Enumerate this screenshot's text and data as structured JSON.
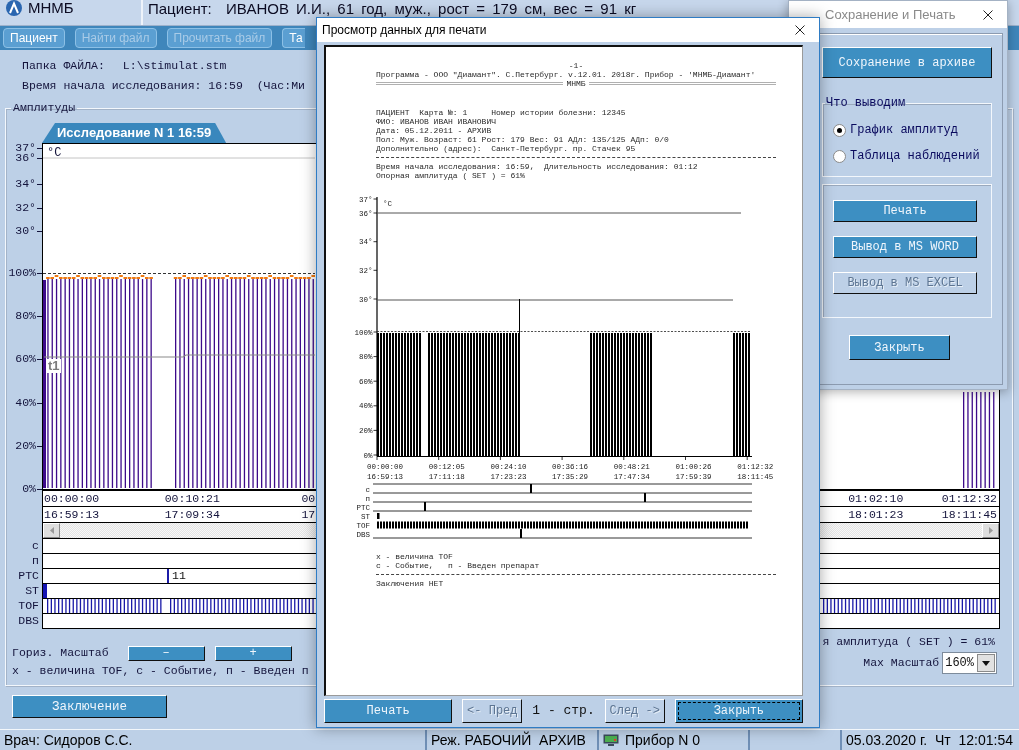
{
  "header": {
    "app_name": "МНМБ",
    "patient": "Пациент:  ИВАНОВ И.И., 61 год, муж., рост = 179 см, вес = 91 кг"
  },
  "toolbar": [
    {
      "label": "Пациент",
      "disabled": false
    },
    {
      "label": "Найти файл",
      "disabled": true
    },
    {
      "label": "Прочитать файл",
      "disabled": true
    },
    {
      "label": "Та",
      "disabled": false
    }
  ],
  "file_folder": {
    "label": "Папка ФАЙЛА:",
    "value": "L:\\stimulat.stm"
  },
  "start_time": "Время начала исследования: 16:59  (Час:Ми",
  "amplitudes": {
    "title": "Амплитуды",
    "tabs": [
      {
        "label": "Исследование N 1 16:59",
        "selected": true
      }
    ],
    "unit": "°C",
    "y_labels": [
      "37°",
      "36°",
      "34°",
      "32°",
      "30°",
      "100%",
      "80%",
      "60%",
      "40%",
      "20%",
      "0%"
    ],
    "trend_marker": "t1",
    "time_axis": {
      "left": [
        {
          "elapsed": "00:00:00",
          "clock": "16:59:13"
        },
        {
          "elapsed": "00:10:21",
          "clock": "17:09:34"
        },
        {
          "elapsed": "00",
          "clock": "17"
        }
      ],
      "right": [
        {
          "elapsed": "01:02:10",
          "clock": "18:01:23"
        },
        {
          "elapsed": "01:12:32",
          "clock": "18:11:45"
        }
      ]
    },
    "event_rows": [
      {
        "label": "с",
        "kind": "plain"
      },
      {
        "label": "п",
        "kind": "plain"
      },
      {
        "label": "PTC",
        "kind": "count",
        "value": "11"
      },
      {
        "label": "ST",
        "kind": "start"
      },
      {
        "label": "TOF",
        "kind": "train"
      },
      {
        "label": "DBS",
        "kind": "plain"
      }
    ],
    "scale": {
      "label": "Гориз. Масштаб",
      "buttons": [
        "–",
        "+"
      ]
    },
    "legend": "х - величина TOF, с - Событие, п - Введен п",
    "set_amplitude": "я амплитуда ( SET ) = 61%",
    "max_scale": {
      "label": "Max Масштаб",
      "value": "160%"
    }
  },
  "conclusion_button": "Заключение",
  "status_bar": {
    "doctor": "Врач: Сидоров С.С.",
    "mode": "Реж. РАБОЧИЙ  АРХИВ",
    "device": "Прибор N 0",
    "datetime": "05.03.2020 г.  Чт  12:01:54"
  },
  "print_preview": {
    "title": "Просмотр данных для печати",
    "active": true,
    "page": {
      "number": "-1-",
      "program": "Программа - ООО \"Диамант\". С.Петербург. v.12.01. 2018г. Прибор - 'МНМБ-Диамант'",
      "banner": "МНМБ",
      "patient_lines": [
        "ПАЦИЕНТ  Карта №: 1     Номер истории болезни: 12345",
        "ФИО: ИВАНОВ ИВАН ИВАНОВИЧ",
        "Дата: 05.12.2011 - АРХИВ",
        "Пол: Муж. Возраст: 61 Рост: 179 Вес: 91 АДл: 135/125 АДп: 0/0",
        "Дополнительно (адрес):  Санкт-Петербург. пр. Стачек 95"
      ],
      "study_lines": [
        "Время начала исследования: 16:59,  Длительность исследования: 01:12",
        "Опорная амплитуда ( SET ) = 61%"
      ],
      "chart": {
        "unit": "°C",
        "y_labels": [
          "37°",
          "36°",
          "34°",
          "32°",
          "30°",
          "100%",
          "80%",
          "60%",
          "40%",
          "20%",
          "0%"
        ],
        "time_labels": [
          {
            "elapsed": "00:00:00",
            "clock": "16:59:13"
          },
          {
            "elapsed": "00:12:05",
            "clock": "17:11:18"
          },
          {
            "elapsed": "00:24:10",
            "clock": "17:23:23"
          },
          {
            "elapsed": "00:36:16",
            "clock": "17:35:29"
          },
          {
            "elapsed": "00:48:21",
            "clock": "17:47:34"
          },
          {
            "elapsed": "01:00:26",
            "clock": "17:59:39"
          },
          {
            "elapsed": "01:12:32",
            "clock": "18:11:45"
          }
        ],
        "rows": [
          {
            "label": "с",
            "kind": "tick"
          },
          {
            "label": "п",
            "kind": "tick"
          },
          {
            "label": "PTC",
            "kind": "tick"
          },
          {
            "label": "ST",
            "kind": "start"
          },
          {
            "label": "TOF",
            "kind": "train"
          },
          {
            "label": "DBS",
            "kind": "tick"
          }
        ]
      },
      "legend_lines": [
        "х - величина TOF",
        "с - Событие,   п - Введен препарат"
      ],
      "conclusion": "Заключения НЕТ"
    },
    "footer": [
      {
        "kind": "button",
        "label": "Печать",
        "disabled": false,
        "focused": false
      },
      {
        "kind": "button",
        "label": "<- Пред",
        "disabled": true,
        "focused": false
      },
      {
        "kind": "counter",
        "label": "1 - стр."
      },
      {
        "kind": "button",
        "label": "След ->",
        "disabled": true,
        "focused": false
      },
      {
        "kind": "button",
        "label": "Закрыть",
        "disabled": false,
        "focused": true
      }
    ]
  },
  "save_dialog": {
    "title": "Сохранение и Печать",
    "active": false,
    "archive_button": "Сохранение в архиве",
    "output_group": {
      "title": "Что выводим",
      "options": [
        {
          "label": "График амплитуд",
          "selected": true
        },
        {
          "label": "Таблица наблюдений",
          "selected": false
        }
      ]
    },
    "actions": [
      {
        "label": "Печать",
        "disabled": false
      },
      {
        "label": "Вывод в MS WORD",
        "disabled": false
      },
      {
        "label": "Вывод в MS EXCEL",
        "disabled": true
      }
    ],
    "close_button": "Закрыть"
  }
}
